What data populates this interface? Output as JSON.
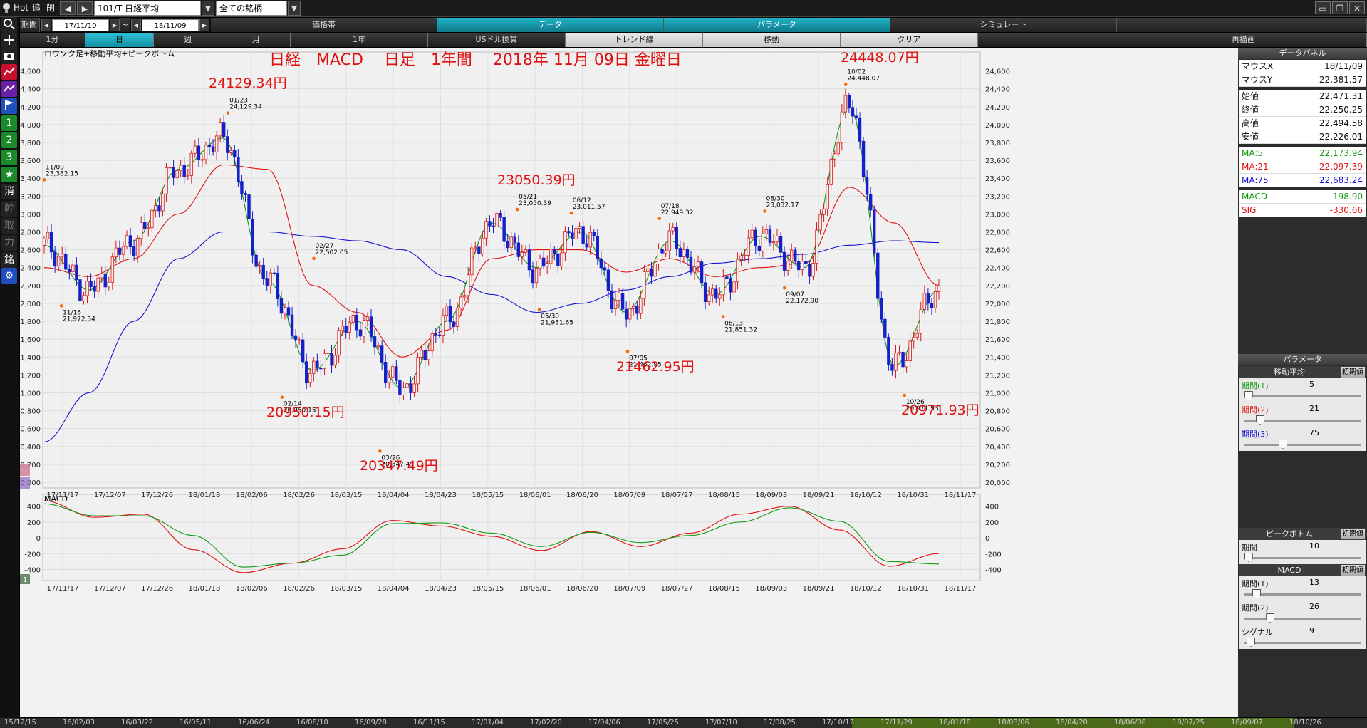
{
  "topbar": {
    "hot": "Hot",
    "menu_add": "追",
    "menu_del": "削",
    "symbol": "101/T 日経平均",
    "universe": "全ての銘柄"
  },
  "tabs_row": {
    "period_label": "期間",
    "from_date": "17/11/10",
    "tilde": "~",
    "to_date": "18/11/09",
    "tabs": [
      "価格帯",
      "データ",
      "パラメータ",
      "シミュレート"
    ]
  },
  "timeframe_row": {
    "items": [
      "1分",
      "日",
      "週",
      "月",
      "1年",
      "USドル換算",
      "トレンド線",
      "移動",
      "クリア",
      "再描画"
    ],
    "selected": "日"
  },
  "left_toolbar": {
    "items": [
      "1",
      "2",
      "3",
      "消",
      "幹",
      "取",
      "力",
      "銘"
    ]
  },
  "chart": {
    "subtitle": "ロウソク足+移動平均+ピークボトム",
    "title": "日経　MACD　 日足　1年間　 2018年 11月 09日 金曜日",
    "macd_label": "MACD",
    "x_tick_labels": [
      "17/11/17",
      "17/12/07",
      "17/12/26",
      "18/01/18",
      "18/02/06",
      "18/02/26",
      "18/03/15",
      "18/04/04",
      "18/04/23",
      "18/05/15",
      "18/06/01",
      "18/06/20",
      "18/07/09",
      "18/07/27",
      "18/08/15",
      "18/09/03",
      "18/09/21",
      "18/10/12",
      "18/10/31",
      "18/11/17"
    ],
    "big_labels": [
      "24129.34円",
      "23050.39円",
      "24448.07円",
      "20950.15円",
      "20347.49円",
      "21462.95円",
      "20971.93円"
    ],
    "peak_labels": [
      {
        "d": "11/09",
        "v": "23,382.15"
      },
      {
        "d": "11/16",
        "v": "21,972.34"
      },
      {
        "d": "01/23",
        "v": "24,129.34"
      },
      {
        "d": "02/14",
        "v": "20,950.15"
      },
      {
        "d": "02/27",
        "v": "22,502.05"
      },
      {
        "d": "03/26",
        "v": "20,347.49"
      },
      {
        "d": "05/21",
        "v": "23,050.39"
      },
      {
        "d": "05/30",
        "v": "21,931.65"
      },
      {
        "d": "06/12",
        "v": "23,011.57"
      },
      {
        "d": "07/05",
        "v": "21,462.95"
      },
      {
        "d": "07/18",
        "v": "22,949.32"
      },
      {
        "d": "08/13",
        "v": "21,851.32"
      },
      {
        "d": "08/30",
        "v": "23,032.17"
      },
      {
        "d": "09/07",
        "v": "22,172.90"
      },
      {
        "d": "10/02",
        "v": "24,448.07"
      },
      {
        "d": "10/26",
        "v": "20,971.93"
      }
    ],
    "colors": {
      "up": "#d81818",
      "down": "#1520c8",
      "ma5": "#119911",
      "ma21": "#e01010",
      "ma75": "#1515d0"
    }
  },
  "chart_data": [
    {
      "type": "line",
      "subtitle": "ロウソク足+移動平均+ピークボトム",
      "y_ticks": [
        "24,600",
        "24,400",
        "24,200",
        "24,000",
        "23,800",
        "23,600",
        "23,400",
        "23,200",
        "23,000",
        "22,800",
        "22,600",
        "22,400",
        "22,200",
        "22,000",
        "21,800",
        "21,600",
        "21,400",
        "21,200",
        "21,000",
        "20,800",
        "20,600",
        "20,400",
        "20,200",
        "20,000"
      ],
      "ylim": [
        20000,
        24700
      ],
      "x": [
        "17/11/09",
        "17/11/16",
        "17/12/07",
        "18/01/05",
        "18/01/23",
        "18/02/06",
        "18/02/14",
        "18/02/27",
        "18/03/26",
        "18/04/17",
        "18/05/21",
        "18/05/30",
        "18/06/12",
        "18/07/05",
        "18/07/18",
        "18/08/13",
        "18/08/30",
        "18/09/07",
        "18/10/02",
        "18/10/26",
        "18/11/09"
      ],
      "series": [
        {
          "name": "MA:5",
          "values": [
            22650,
            22150,
            22700,
            23500,
            23850,
            22250,
            21250,
            21800,
            21050,
            21800,
            22900,
            22400,
            22800,
            21900,
            22700,
            22100,
            22750,
            22400,
            24200,
            21300,
            22150
          ]
        },
        {
          "name": "MA:21",
          "values": [
            22400,
            22300,
            22500,
            23000,
            23550,
            23500,
            22200,
            21900,
            21400,
            21700,
            22500,
            22600,
            22600,
            22350,
            22500,
            22300,
            22400,
            22450,
            23300,
            22900,
            22200
          ]
        },
        {
          "name": "MA:75",
          "values": [
            20450,
            21000,
            21800,
            22500,
            22800,
            22800,
            22750,
            22700,
            22600,
            22300,
            22100,
            21900,
            22000,
            22150,
            22300,
            22450,
            22500,
            22550,
            22650,
            22700,
            22680
          ]
        }
      ],
      "peaks": [
        {
          "x": "11/09",
          "value": 23382.15
        },
        {
          "x": "11/16",
          "value": 21972.34
        },
        {
          "x": "01/23",
          "value": 24129.34
        },
        {
          "x": "02/14",
          "value": 20950.15
        },
        {
          "x": "02/27",
          "value": 22502.05
        },
        {
          "x": "03/26",
          "value": 20347.49
        },
        {
          "x": "05/21",
          "value": 23050.39
        },
        {
          "x": "05/30",
          "value": 21931.65
        },
        {
          "x": "06/12",
          "value": 23011.57
        },
        {
          "x": "07/05",
          "value": 21462.95
        },
        {
          "x": "07/18",
          "value": 22949.32
        },
        {
          "x": "08/13",
          "value": 21851.32
        },
        {
          "x": "08/30",
          "value": 23032.17
        },
        {
          "x": "09/07",
          "value": 22172.9
        },
        {
          "x": "10/02",
          "value": 24448.07
        },
        {
          "x": "10/26",
          "value": 20971.93
        }
      ]
    },
    {
      "type": "line",
      "title": "MACD",
      "y_ticks": [
        "400",
        "200",
        "0",
        "-200",
        "-400"
      ],
      "ylim": [
        -450,
        460
      ],
      "x": [
        "17/11/09",
        "17/12/07",
        "18/01/18",
        "18/02/06",
        "18/02/26",
        "18/03/15",
        "18/04/04",
        "18/05/15",
        "18/06/01",
        "18/06/20",
        "18/07/09",
        "18/07/27",
        "18/08/15",
        "18/09/03",
        "18/09/21",
        "18/10/02",
        "18/10/12",
        "18/10/31",
        "18/11/09"
      ],
      "series": [
        {
          "name": "MACD",
          "values": [
            470,
            260,
            300,
            -150,
            -440,
            -320,
            -140,
            220,
            150,
            20,
            -160,
            80,
            -110,
            60,
            300,
            400,
            100,
            -360,
            -199
          ]
        },
        {
          "name": "SIG",
          "values": [
            430,
            280,
            280,
            30,
            -370,
            -320,
            -220,
            180,
            190,
            60,
            -110,
            70,
            -60,
            30,
            200,
            380,
            210,
            -300,
            -331
          ]
        }
      ]
    }
  ],
  "data_panel": {
    "title": "データパネル",
    "rows": [
      {
        "k": "マウスX",
        "v": "18/11/09"
      },
      {
        "k": "マウスY",
        "v": "22,381.57"
      },
      {
        "k": "始値",
        "v": "22,471.31"
      },
      {
        "k": "終値",
        "v": "22,250.25"
      },
      {
        "k": "高値",
        "v": "22,494.58"
      },
      {
        "k": "安値",
        "v": "22,226.01"
      },
      {
        "k": "MA:5",
        "v": "22,173.94"
      },
      {
        "k": "MA:21",
        "v": "22,097.39"
      },
      {
        "k": "MA:75",
        "v": "22,683.24"
      },
      {
        "k": "MACD",
        "v": "-198.90"
      },
      {
        "k": "SIG",
        "v": "-330.66"
      }
    ]
  },
  "param_panel": {
    "title": "パラメータ",
    "ma_title": "移動平均",
    "reset": "初期値",
    "ma_rows": [
      {
        "k": "期間(1)",
        "v": "5"
      },
      {
        "k": "期間(2)",
        "v": "21"
      },
      {
        "k": "期間(3)",
        "v": "75"
      }
    ],
    "pb_title": "ピークボトム",
    "pb_rows": [
      {
        "k": "期間",
        "v": "10"
      }
    ],
    "macd_title": "MACD",
    "macd_rows": [
      {
        "k": "期間(1)",
        "v": "13"
      },
      {
        "k": "期間(2)",
        "v": "26"
      },
      {
        "k": "シグナル",
        "v": "9"
      }
    ],
    "slider_levels": [
      0.03,
      0.13,
      0.33,
      0.03,
      0.1,
      0.22,
      0.05
    ]
  },
  "bottom_dates": [
    "15/12/15",
    "16/02/03",
    "16/03/22",
    "16/05/11",
    "16/06/24",
    "16/08/10",
    "16/09/28",
    "16/11/15",
    "17/01/04",
    "17/02/20",
    "17/04/06",
    "17/05/25",
    "17/07/10",
    "17/08/25",
    "17/10/12",
    "17/11/29",
    "18/01/18",
    "18/03/06",
    "18/04/20",
    "18/06/08",
    "18/07/25",
    "18/09/07",
    "18/10/26"
  ]
}
